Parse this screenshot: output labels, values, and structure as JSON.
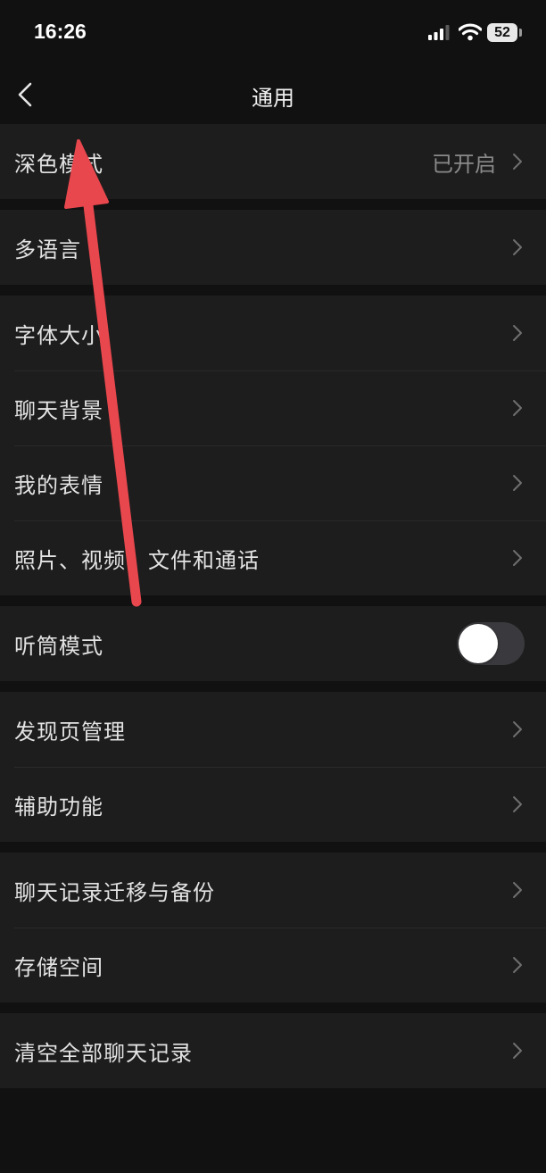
{
  "status": {
    "time": "16:26",
    "battery": "52"
  },
  "nav": {
    "title": "通用"
  },
  "groups": [
    {
      "rows": [
        {
          "label": "深色模式",
          "value": "已开启"
        }
      ]
    },
    {
      "rows": [
        {
          "label": "多语言"
        }
      ]
    },
    {
      "rows": [
        {
          "label": "字体大小"
        },
        {
          "label": "聊天背景"
        },
        {
          "label": "我的表情"
        },
        {
          "label": "照片、视频、文件和通话"
        }
      ]
    },
    {
      "rows": [
        {
          "label": "听筒模式",
          "toggle": false
        }
      ]
    },
    {
      "rows": [
        {
          "label": "发现页管理"
        },
        {
          "label": "辅助功能"
        }
      ]
    },
    {
      "rows": [
        {
          "label": "聊天记录迁移与备份"
        },
        {
          "label": "存储空间"
        }
      ]
    },
    {
      "rows": [
        {
          "label": "清空全部聊天记录"
        }
      ]
    }
  ],
  "icons": {
    "back": "chevron-left-icon",
    "row_chevron": "chevron-right-icon",
    "annotation": "red-arrow-annotation"
  },
  "colors": {
    "background": "#111111",
    "cell": "#1d1d1d",
    "annotation_arrow": "#e8474d"
  }
}
